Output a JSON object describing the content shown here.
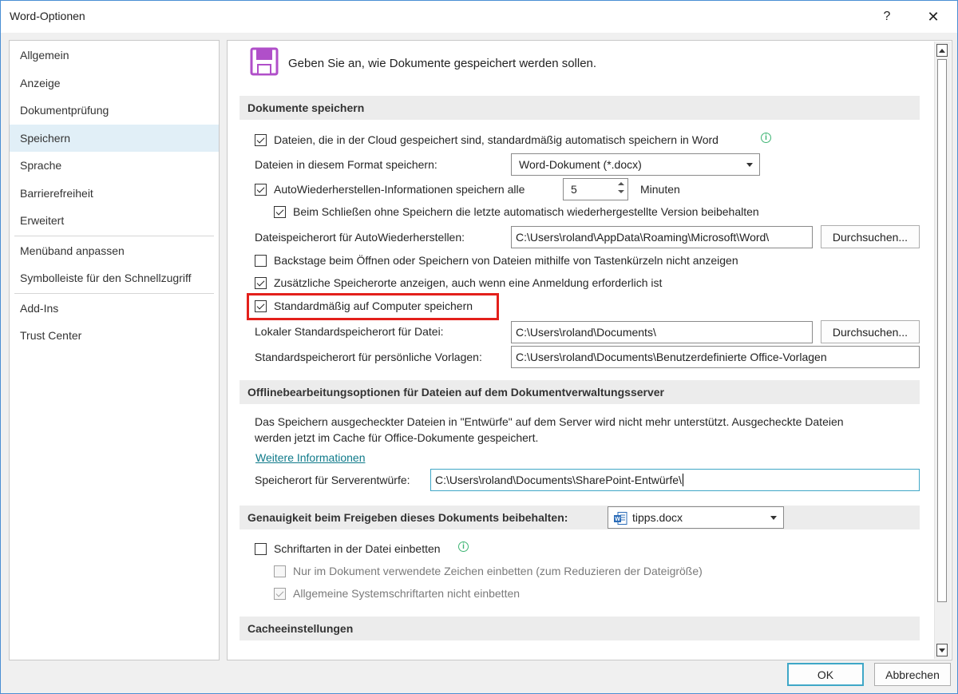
{
  "window": {
    "title": "Word-Optionen",
    "help_label": "?",
    "close_label": "✕"
  },
  "nav": {
    "items": [
      {
        "label": "Allgemein"
      },
      {
        "label": "Anzeige"
      },
      {
        "label": "Dokumentprüfung"
      },
      {
        "label": "Speichern"
      },
      {
        "label": "Sprache"
      },
      {
        "label": "Barrierefreiheit"
      },
      {
        "label": "Erweitert"
      },
      {
        "label": "Menüband anpassen"
      },
      {
        "label": "Symbolleiste für den Schnellzugriff"
      },
      {
        "label": "Add-Ins"
      },
      {
        "label": "Trust Center"
      }
    ],
    "selected": "Speichern"
  },
  "main": {
    "header": "Geben Sie an, wie Dokumente gespeichert werden sollen.",
    "save_section": {
      "title": "Dokumente speichern",
      "autosave_cloud": {
        "label": "Dateien, die in der Cloud gespeichert sind, standardmäßig automatisch speichern in Word",
        "checked": true
      },
      "format_label": "Dateien in diesem Format speichern:",
      "format_value": "Word-Dokument (*.docx)",
      "autorecover": {
        "label": "AutoWiederherstellen-Informationen speichern alle",
        "checked": true
      },
      "autorecover_minutes": "5",
      "minutes_label": "Minuten",
      "keep_last": {
        "label": "Beim Schließen ohne Speichern die letzte automatisch wiederhergestellte Version beibehalten",
        "checked": true
      },
      "autorecover_path_label": "Dateispeicherort für AutoWiederherstellen:",
      "autorecover_path": "C:\\Users\\roland\\AppData\\Roaming\\Microsoft\\Word\\",
      "browse_label": "Durchsuchen...",
      "no_backstage": {
        "label": "Backstage beim Öffnen oder Speichern von Dateien mithilfe von Tastenkürzeln nicht anzeigen",
        "checked": false
      },
      "extra_locations": {
        "label": "Zusätzliche Speicherorte anzeigen, auch wenn eine Anmeldung erforderlich ist",
        "checked": true
      },
      "save_to_computer": {
        "label": "Standardmäßig auf Computer speichern",
        "checked": true
      },
      "local_path_label": "Lokaler Standardspeicherort für Datei:",
      "local_path": "C:\\Users\\roland\\Documents\\",
      "templates_label": "Standardspeicherort für persönliche Vorlagen:",
      "templates_path": "C:\\Users\\roland\\Documents\\Benutzerdefinierte Office-Vorlagen"
    },
    "offline_section": {
      "title": "Offlinebearbeitungsoptionen für Dateien auf dem Dokumentverwaltungsserver",
      "text_line1": "Das Speichern ausgecheckter Dateien in \"Entwürfe\" auf dem Server wird nicht mehr unterstützt. Ausgecheckte Dateien",
      "text_line2": "werden jetzt im Cache für Office-Dokumente gespeichert.",
      "more_info": "Weitere Informationen",
      "drafts_label": "Speicherort für Serverentwürfe:",
      "drafts_path": "C:\\Users\\roland\\Documents\\SharePoint-Entwürfe\\"
    },
    "fidelity_section": {
      "title": "Genauigkeit beim Freigeben dieses Dokuments beibehalten:",
      "document": "tipps.docx",
      "embed_fonts": {
        "label": "Schriftarten in der Datei einbetten",
        "checked": false
      },
      "embed_used_only": {
        "label": "Nur im Dokument verwendete Zeichen einbetten (zum Reduzieren der Dateigröße)",
        "checked": false
      },
      "no_system_fonts": {
        "label": "Allgemeine Systemschriftarten nicht einbetten",
        "checked": true
      }
    },
    "cache_section": {
      "title": "Cacheeinstellungen"
    }
  },
  "footer": {
    "ok_label": "OK",
    "cancel_label": "Abbrechen"
  },
  "colors": {
    "accent": "#3fa7c7",
    "highlight": "#e3201b",
    "selected_nav": "#e1eff7",
    "save_icon": "#b04fc9",
    "info_icon": "#3fb574"
  }
}
